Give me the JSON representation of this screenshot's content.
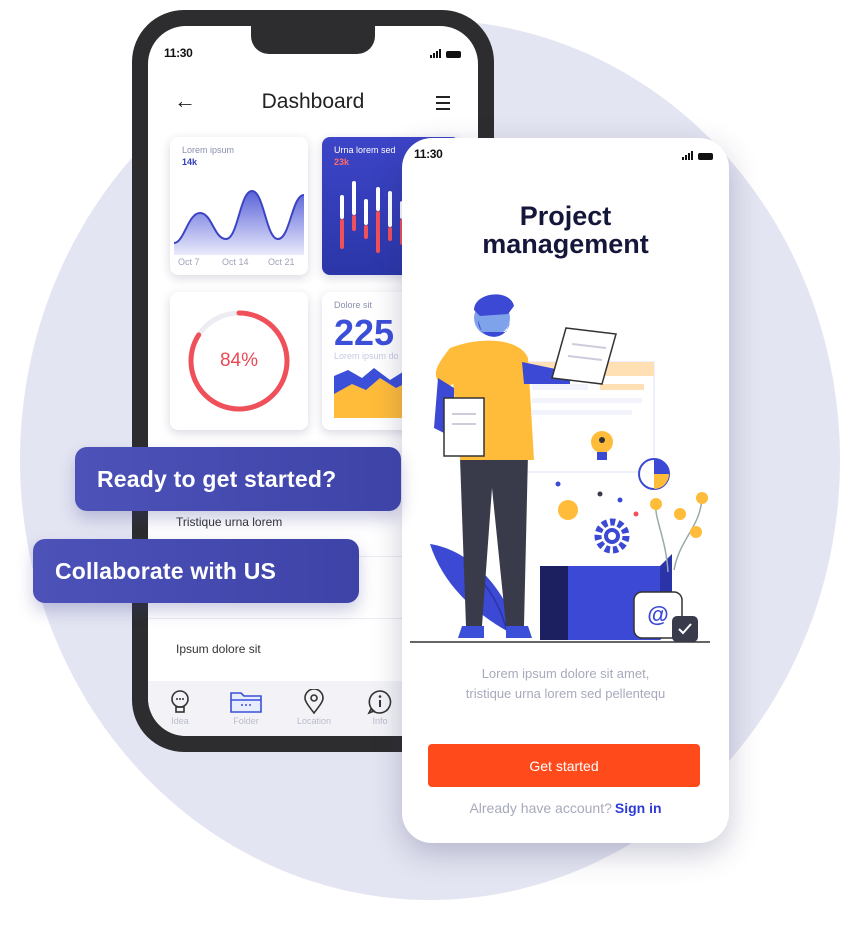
{
  "colors": {
    "accent_blue": "#3b4fd8",
    "accent_orange": "#ff4a1c",
    "donut_red": "#f0505a",
    "pill_purple": "#474cb2"
  },
  "dashboard_phone": {
    "time": "11:30",
    "title": "Dashboard",
    "back_icon": "arrow-left-icon",
    "menu_icon": "hamburger-menu-icon",
    "card1": {
      "label": "Lorem ipsum",
      "value": "14k",
      "dates": [
        "Oct 7",
        "Oct 14",
        "Oct 21"
      ]
    },
    "card2": {
      "label": "Urna lorem sed",
      "value": "23k"
    },
    "card3": {
      "percent_text": "84%",
      "percent": 84
    },
    "card4": {
      "label": "Dolore sit",
      "number": "225",
      "sub": "Lorem ipsum do"
    },
    "list": [
      "Tristique urna lorem",
      "Ipsum dolore sit"
    ],
    "tabs": [
      {
        "label": "Idea",
        "icon": "lightbulb-icon"
      },
      {
        "label": "Folder",
        "icon": "folder-icon"
      },
      {
        "label": "Location",
        "icon": "location-pin-icon"
      },
      {
        "label": "Info",
        "icon": "info-icon"
      }
    ]
  },
  "pills": [
    "Ready to get started?",
    "Collaborate with US"
  ],
  "onboarding_phone": {
    "time": "11:30",
    "title_line1": "Project",
    "title_line2": "management",
    "desc_line1": "Lorem ipsum dolore sit amet,",
    "desc_line2": "tristique urna lorem sed pellentequ",
    "button": "Get started",
    "account_text": "Already have account?",
    "signin": "Sign in"
  }
}
